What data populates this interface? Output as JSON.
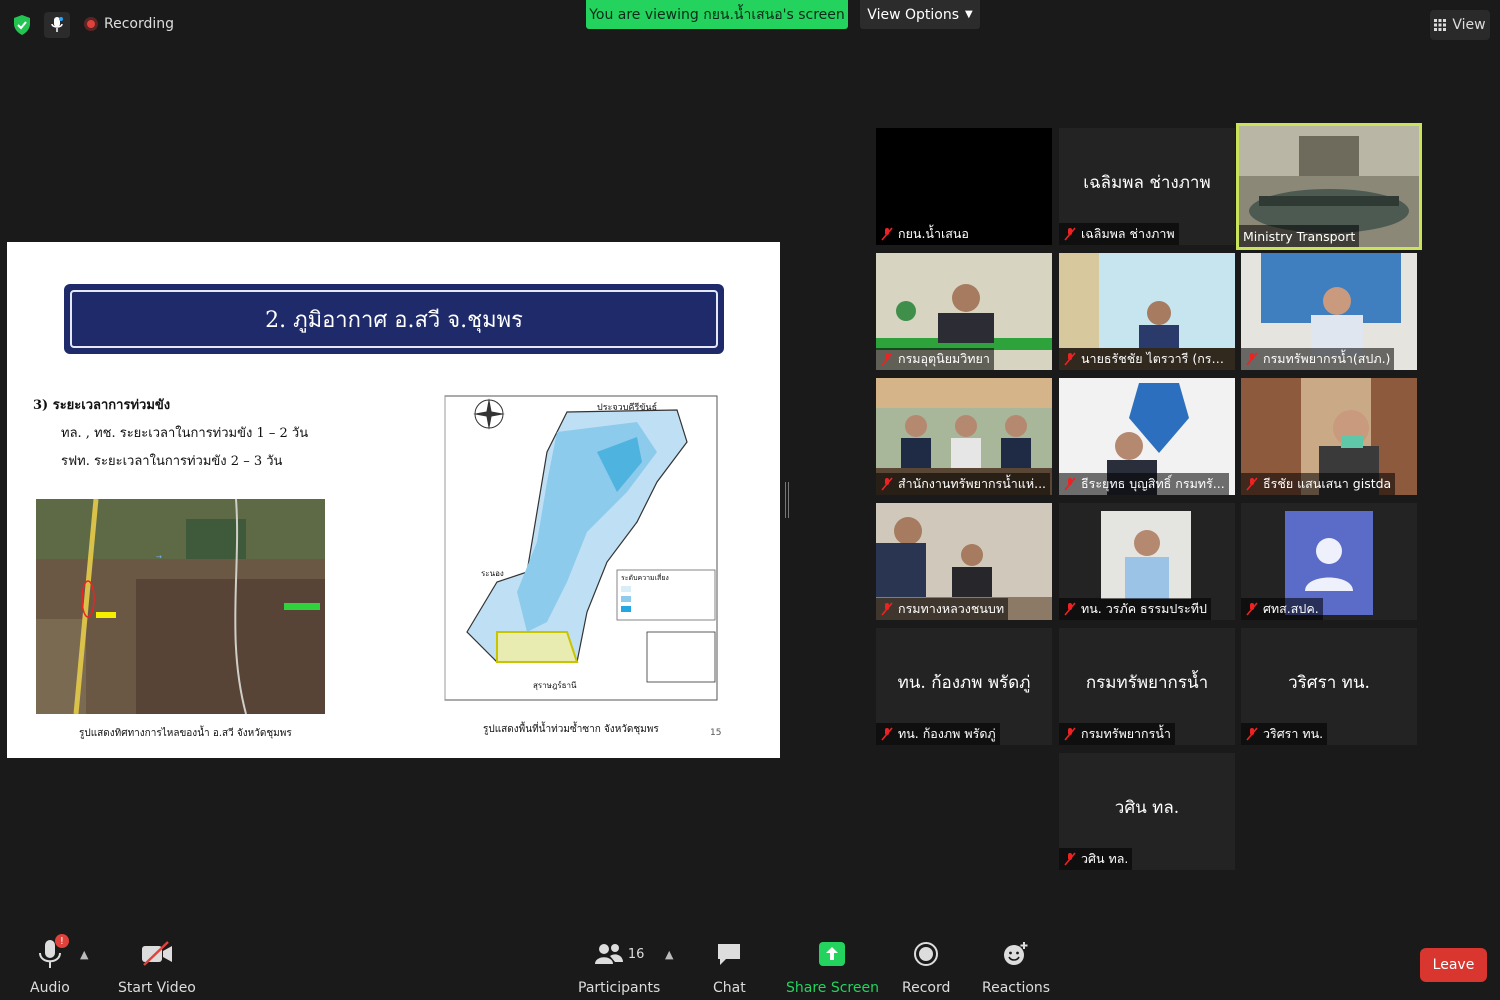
{
  "topbar": {
    "recording_label": "Recording",
    "viewing_banner": "You are viewing กยน.น้ำเสนอ's screen",
    "view_options_label": "View Options",
    "view_label": "View"
  },
  "slide": {
    "title": "2. ภูมิอากาศ อ.สวี จ.ชุมพร",
    "section": "3) ระยะเวลาการท่วมขัง",
    "line1": "ทล. , ทช. ระยะเวลาในการท่วมขัง 1 – 2 วัน",
    "line2": "รฟท. ระยะเวลาในการท่วมขัง 2 – 3 วัน",
    "caption_left": "รูปแสดงทิศทางการไหลของน้ำ อ.สวี จังหวัดชุมพร",
    "caption_right": "รูปแสดงพื้นที่น้ำท่วมซ้ำซาก จังหวัดชุมพร",
    "page_number": "15",
    "map_labels": {
      "north": "ประจวบคีรีขันธ์",
      "west": "ระนอง",
      "south": "สุราษฎร์ธานี",
      "legend_title": "ระดับความเสี่ยง"
    }
  },
  "participants": [
    {
      "big": "",
      "name": "กยน.น้ำเสนอ"
    },
    {
      "big": "เฉลิมพล ช่างภาพ",
      "name": "เฉลิมพล ช่างภาพ"
    },
    {
      "big": "",
      "name": "Ministry Transport"
    },
    {
      "big": "",
      "name": "กรมอุตุนิยมวิทยา"
    },
    {
      "big": "",
      "name": "นายธรัชชัย ไตรวารี (กรม..."
    },
    {
      "big": "",
      "name": "กรมทรัพยากรน้ำ(สปภ.)"
    },
    {
      "big": "",
      "name": "สำนักงานทรัพยากรน้ำแห่..."
    },
    {
      "big": "",
      "name": "ธีระยุทธ บุญสิทธิ์ กรมทรั..."
    },
    {
      "big": "",
      "name": "ธีรชัย แสนเสนา gistda"
    },
    {
      "big": "",
      "name": "กรมทางหลวงชนบท"
    },
    {
      "big": "",
      "name": "ทน. วรภัค ธรรมประทีป"
    },
    {
      "big": "",
      "name": "ศทส.สปค."
    },
    {
      "big": "ทน. ก้องภพ พรัดภู่",
      "name": "ทน. ก้องภพ พรัดภู่"
    },
    {
      "big": "กรมทรัพยากรน้ำ",
      "name": "กรมทรัพยากรน้ำ"
    },
    {
      "big": "วริศรา ทน.",
      "name": "วริศรา ทน."
    },
    {
      "big": "วศิน ทล.",
      "name": "วศิน ทล."
    }
  ],
  "toolbar": {
    "audio": "Audio",
    "start_video": "Start Video",
    "participants": "Participants",
    "participants_count": "16",
    "chat": "Chat",
    "share_screen": "Share Screen",
    "record": "Record",
    "reactions": "Reactions",
    "leave": "Leave",
    "audio_alert": "!"
  },
  "colors": {
    "background": "#1a1a1a",
    "viewing_banner": "#23d35e",
    "share_screen": "#23d35e",
    "leave": "#d8362f",
    "active_speaker": "#c9e35b",
    "slide_title_bg": "#1f2a6b"
  }
}
